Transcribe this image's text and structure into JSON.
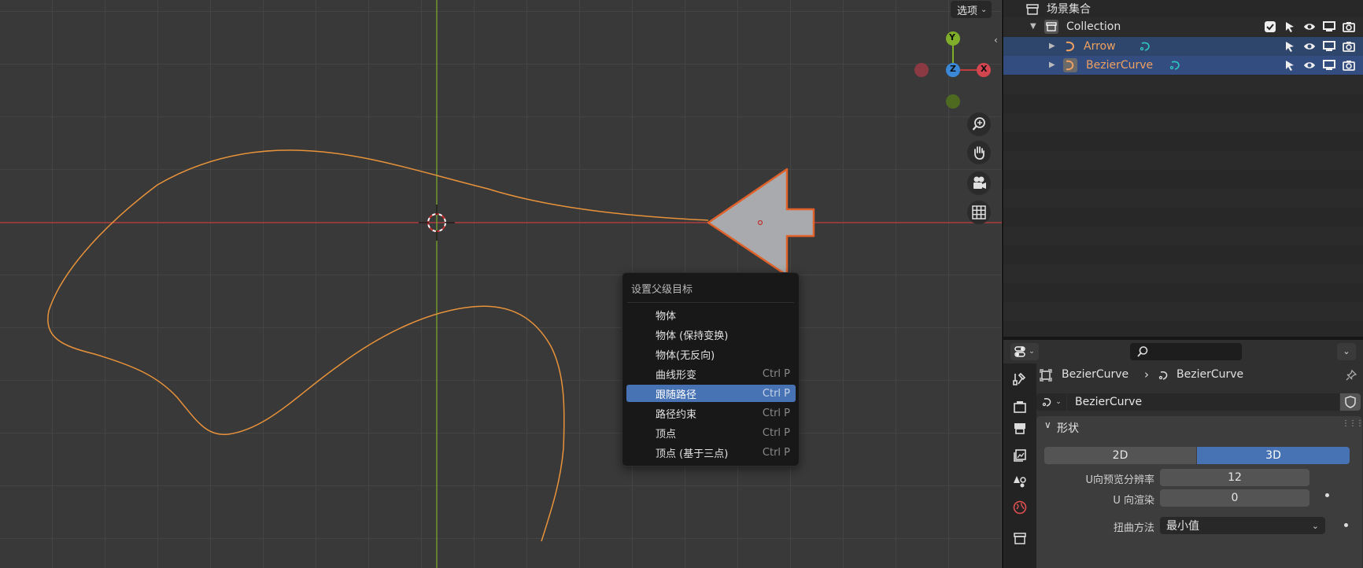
{
  "viewport": {
    "options_label": "选项",
    "gizmo": {
      "x_label": "X",
      "y_label": "Y",
      "z_label": "Z"
    },
    "nav_icons": [
      "zoom-icon",
      "hand-pan-icon",
      "camera-icon",
      "grid-icon"
    ],
    "colors": {
      "curve": "#e8923a",
      "x_axis": "#c23b3b",
      "y_axis": "#7fae2a",
      "arrow_fill": "#a8aaad",
      "arrow_outline": "#e0612a"
    }
  },
  "context_menu": {
    "title": "设置父级目标",
    "items": [
      {
        "label": "物体",
        "shortcut": ""
      },
      {
        "label": "物体 (保持变换)",
        "shortcut": ""
      },
      {
        "label": "物体(无反向)",
        "shortcut": ""
      },
      {
        "label": "曲线形变",
        "shortcut": "Ctrl P"
      },
      {
        "label": "跟随路径",
        "shortcut": "Ctrl P",
        "active": true
      },
      {
        "label": "路径约束",
        "shortcut": "Ctrl P"
      },
      {
        "label": "顶点",
        "shortcut": "Ctrl P"
      },
      {
        "label": "顶点 (基于三点)",
        "shortcut": "Ctrl P"
      }
    ],
    "active_color": "#4772b3"
  },
  "outliner": {
    "scene_collection": "场景集合",
    "collection": "Collection",
    "objects": [
      {
        "name": "Arrow"
      },
      {
        "name": "BezierCurve"
      }
    ]
  },
  "properties": {
    "breadcrumb": {
      "object": "BezierCurve",
      "data": "BezierCurve"
    },
    "data_name": "BezierCurve",
    "panel_title": "形状",
    "dimensions": {
      "option_2d": "2D",
      "option_3d": "3D",
      "selected": "3D"
    },
    "fields": {
      "u_preview_resolution": {
        "label": "U向预览分辨率",
        "value": "12"
      },
      "u_render": {
        "label": "U 向渲染",
        "value": "0"
      },
      "twist_method": {
        "label": "扭曲方法",
        "value": "最小值"
      }
    }
  }
}
